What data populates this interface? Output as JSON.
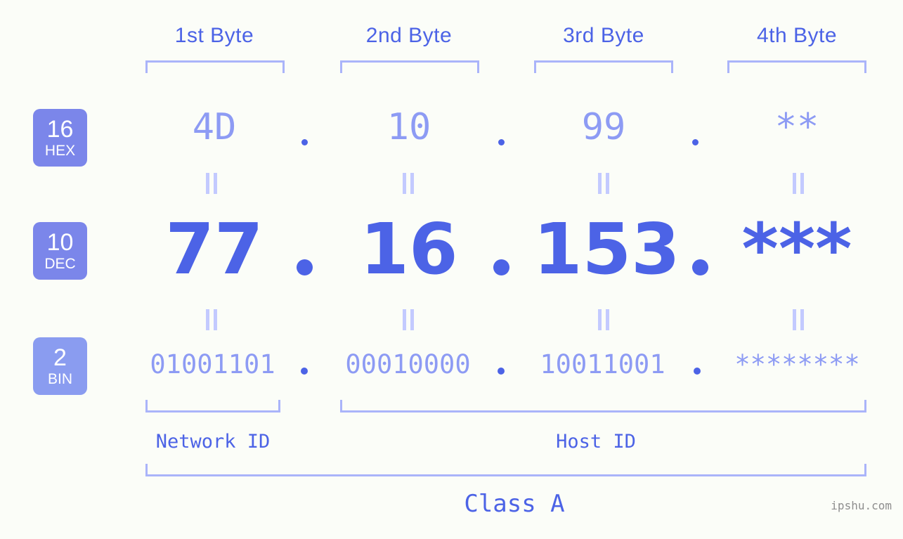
{
  "meta": {
    "background_color": "#fbfdf8",
    "accent_strong": "#4c63e6",
    "accent_light": "#aab4fa",
    "badge_color_hex": "#7b86ea",
    "badge_color_dec": "#7b86ea",
    "badge_color_bin": "#8a9cf0"
  },
  "byte_headers": [
    {
      "label": "1st Byte"
    },
    {
      "label": "2nd Byte"
    },
    {
      "label": "3rd Byte"
    },
    {
      "label": "4th Byte"
    }
  ],
  "rows": [
    {
      "base": "16",
      "base_name": "HEX",
      "values": [
        "4D",
        "10",
        "99",
        "**"
      ],
      "separator": "."
    },
    {
      "base": "10",
      "base_name": "DEC",
      "values": [
        "77",
        "16",
        "153",
        "***"
      ],
      "separator": "."
    },
    {
      "base": "2",
      "base_name": "BIN",
      "values": [
        "01001101",
        "00010000",
        "10011001",
        "********"
      ],
      "separator": "."
    }
  ],
  "connector_symbol": "||",
  "footer": {
    "network_id_label": "Network ID",
    "host_id_label": "Host ID",
    "class_label": "Class A"
  },
  "watermark": "ipshu.com"
}
